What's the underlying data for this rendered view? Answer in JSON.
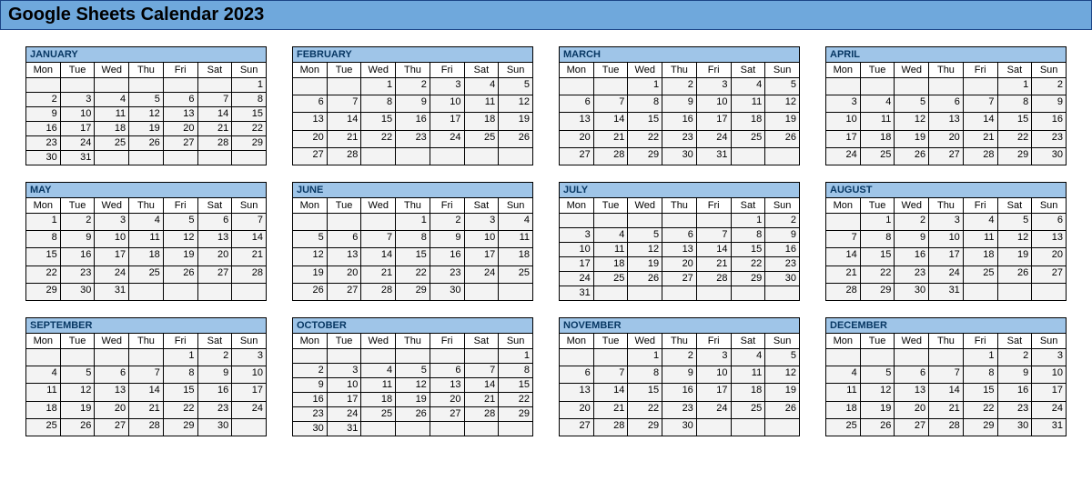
{
  "title": "Google Sheets Calendar 2023",
  "days_of_week": [
    "Mon",
    "Tue",
    "Wed",
    "Thu",
    "Fri",
    "Sat",
    "Sun"
  ],
  "months": [
    {
      "name": "JANUARY",
      "weeks": [
        [
          "",
          "",
          "",
          "",
          "",
          "",
          "1"
        ],
        [
          "2",
          "3",
          "4",
          "5",
          "6",
          "7",
          "8"
        ],
        [
          "9",
          "10",
          "11",
          "12",
          "13",
          "14",
          "15"
        ],
        [
          "16",
          "17",
          "18",
          "19",
          "20",
          "21",
          "22"
        ],
        [
          "23",
          "24",
          "25",
          "26",
          "27",
          "28",
          "29"
        ],
        [
          "30",
          "31",
          "",
          "",
          "",
          "",
          ""
        ]
      ]
    },
    {
      "name": "FEBRUARY",
      "weeks": [
        [
          "",
          "",
          "1",
          "2",
          "3",
          "4",
          "5"
        ],
        [
          "6",
          "7",
          "8",
          "9",
          "10",
          "11",
          "12"
        ],
        [
          "13",
          "14",
          "15",
          "16",
          "17",
          "18",
          "19"
        ],
        [
          "20",
          "21",
          "22",
          "23",
          "24",
          "25",
          "26"
        ],
        [
          "27",
          "28",
          "",
          "",
          "",
          "",
          ""
        ],
        [
          "",
          "",
          "",
          "",
          "",
          "",
          ""
        ]
      ]
    },
    {
      "name": "MARCH",
      "weeks": [
        [
          "",
          "",
          "1",
          "2",
          "3",
          "4",
          "5"
        ],
        [
          "6",
          "7",
          "8",
          "9",
          "10",
          "11",
          "12"
        ],
        [
          "13",
          "14",
          "15",
          "16",
          "17",
          "18",
          "19"
        ],
        [
          "20",
          "21",
          "22",
          "23",
          "24",
          "25",
          "26"
        ],
        [
          "27",
          "28",
          "29",
          "30",
          "31",
          "",
          ""
        ],
        [
          "",
          "",
          "",
          "",
          "",
          "",
          ""
        ]
      ]
    },
    {
      "name": "APRIL",
      "weeks": [
        [
          "",
          "",
          "",
          "",
          "",
          "1",
          "2"
        ],
        [
          "3",
          "4",
          "5",
          "6",
          "7",
          "8",
          "9"
        ],
        [
          "10",
          "11",
          "12",
          "13",
          "14",
          "15",
          "16"
        ],
        [
          "17",
          "18",
          "19",
          "20",
          "21",
          "22",
          "23"
        ],
        [
          "24",
          "25",
          "26",
          "27",
          "28",
          "29",
          "30"
        ],
        [
          "",
          "",
          "",
          "",
          "",
          "",
          ""
        ]
      ]
    },
    {
      "name": "MAY",
      "weeks": [
        [
          "1",
          "2",
          "3",
          "4",
          "5",
          "6",
          "7"
        ],
        [
          "8",
          "9",
          "10",
          "11",
          "12",
          "13",
          "14"
        ],
        [
          "15",
          "16",
          "17",
          "18",
          "19",
          "20",
          "21"
        ],
        [
          "22",
          "23",
          "24",
          "25",
          "26",
          "27",
          "28"
        ],
        [
          "29",
          "30",
          "31",
          "",
          "",
          "",
          ""
        ],
        [
          "",
          "",
          "",
          "",
          "",
          "",
          ""
        ]
      ]
    },
    {
      "name": "JUNE",
      "weeks": [
        [
          "",
          "",
          "",
          "1",
          "2",
          "3",
          "4"
        ],
        [
          "5",
          "6",
          "7",
          "8",
          "9",
          "10",
          "11"
        ],
        [
          "12",
          "13",
          "14",
          "15",
          "16",
          "17",
          "18"
        ],
        [
          "19",
          "20",
          "21",
          "22",
          "23",
          "24",
          "25"
        ],
        [
          "26",
          "27",
          "28",
          "29",
          "30",
          "",
          ""
        ],
        [
          "",
          "",
          "",
          "",
          "",
          "",
          ""
        ]
      ]
    },
    {
      "name": "JULY",
      "weeks": [
        [
          "",
          "",
          "",
          "",
          "",
          "1",
          "2"
        ],
        [
          "3",
          "4",
          "5",
          "6",
          "7",
          "8",
          "9"
        ],
        [
          "10",
          "11",
          "12",
          "13",
          "14",
          "15",
          "16"
        ],
        [
          "17",
          "18",
          "19",
          "20",
          "21",
          "22",
          "23"
        ],
        [
          "24",
          "25",
          "26",
          "27",
          "28",
          "29",
          "30"
        ],
        [
          "31",
          "",
          "",
          "",
          "",
          "",
          ""
        ]
      ]
    },
    {
      "name": "AUGUST",
      "weeks": [
        [
          "",
          "1",
          "2",
          "3",
          "4",
          "5",
          "6"
        ],
        [
          "7",
          "8",
          "9",
          "10",
          "11",
          "12",
          "13"
        ],
        [
          "14",
          "15",
          "16",
          "17",
          "18",
          "19",
          "20"
        ],
        [
          "21",
          "22",
          "23",
          "24",
          "25",
          "26",
          "27"
        ],
        [
          "28",
          "29",
          "30",
          "31",
          "",
          "",
          ""
        ],
        [
          "",
          "",
          "",
          "",
          "",
          "",
          ""
        ]
      ]
    },
    {
      "name": "SEPTEMBER",
      "weeks": [
        [
          "",
          "",
          "",
          "",
          "1",
          "2",
          "3"
        ],
        [
          "4",
          "5",
          "6",
          "7",
          "8",
          "9",
          "10"
        ],
        [
          "11",
          "12",
          "13",
          "14",
          "15",
          "16",
          "17"
        ],
        [
          "18",
          "19",
          "20",
          "21",
          "22",
          "23",
          "24"
        ],
        [
          "25",
          "26",
          "27",
          "28",
          "29",
          "30",
          ""
        ],
        [
          "",
          "",
          "",
          "",
          "",
          "",
          ""
        ]
      ]
    },
    {
      "name": "OCTOBER",
      "weeks": [
        [
          "",
          "",
          "",
          "",
          "",
          "",
          "1"
        ],
        [
          "2",
          "3",
          "4",
          "5",
          "6",
          "7",
          "8"
        ],
        [
          "9",
          "10",
          "11",
          "12",
          "13",
          "14",
          "15"
        ],
        [
          "16",
          "17",
          "18",
          "19",
          "20",
          "21",
          "22"
        ],
        [
          "23",
          "24",
          "25",
          "26",
          "27",
          "28",
          "29"
        ],
        [
          "30",
          "31",
          "",
          "",
          "",
          "",
          ""
        ]
      ]
    },
    {
      "name": "NOVEMBER",
      "weeks": [
        [
          "",
          "",
          "1",
          "2",
          "3",
          "4",
          "5"
        ],
        [
          "6",
          "7",
          "8",
          "9",
          "10",
          "11",
          "12"
        ],
        [
          "13",
          "14",
          "15",
          "16",
          "17",
          "18",
          "19"
        ],
        [
          "20",
          "21",
          "22",
          "23",
          "24",
          "25",
          "26"
        ],
        [
          "27",
          "28",
          "29",
          "30",
          "",
          "",
          ""
        ],
        [
          "",
          "",
          "",
          "",
          "",
          "",
          ""
        ]
      ]
    },
    {
      "name": "DECEMBER",
      "weeks": [
        [
          "",
          "",
          "",
          "",
          "1",
          "2",
          "3"
        ],
        [
          "4",
          "5",
          "6",
          "7",
          "8",
          "9",
          "10"
        ],
        [
          "11",
          "12",
          "13",
          "14",
          "15",
          "16",
          "17"
        ],
        [
          "18",
          "19",
          "20",
          "21",
          "22",
          "23",
          "24"
        ],
        [
          "25",
          "26",
          "27",
          "28",
          "29",
          "30",
          "31"
        ],
        [
          "",
          "",
          "",
          "",
          "",
          "",
          ""
        ]
      ]
    }
  ]
}
